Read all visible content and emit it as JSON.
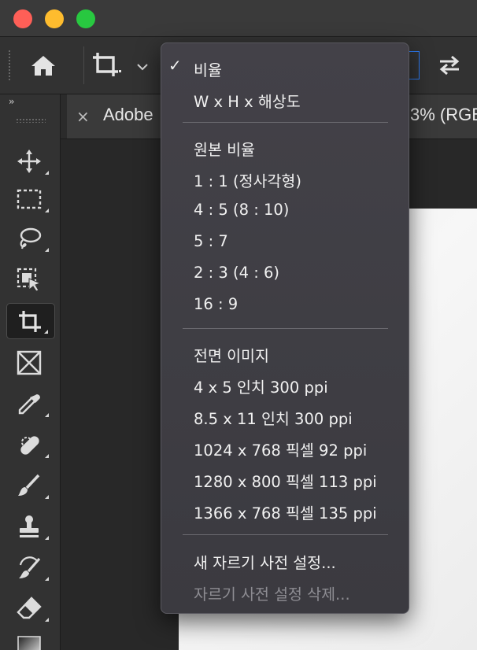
{
  "document_tab": {
    "close_glyph": "×",
    "title_left": "Adobe",
    "title_right": "3% (RGB"
  },
  "toolbar": {
    "collapse_glyph": "››",
    "tools": [
      {
        "icon": "move-icon"
      },
      {
        "icon": "rectangular-marquee-icon"
      },
      {
        "icon": "lasso-icon"
      },
      {
        "icon": "object-selection-icon"
      },
      {
        "icon": "crop-icon",
        "active": true
      },
      {
        "icon": "frame-icon"
      },
      {
        "icon": "eyedropper-icon"
      },
      {
        "icon": "spot-healing-brush-icon"
      },
      {
        "icon": "brush-icon"
      },
      {
        "icon": "clone-stamp-icon"
      },
      {
        "icon": "history-brush-icon"
      },
      {
        "icon": "eraser-icon"
      },
      {
        "icon": "gradient-icon"
      }
    ]
  },
  "options_bar": {
    "home_icon": "home-icon",
    "crop_preset_icon": "crop-icon",
    "dropdown_icon": "chevron-down-icon",
    "swap_icon": "swap-icon"
  },
  "menu": {
    "check_glyph": "✓",
    "items": [
      {
        "label": "비율",
        "checked": true
      },
      {
        "label": "W x H x 해상도"
      },
      {
        "label": "원본 비율"
      },
      {
        "label": "1 : 1 (정사각형)"
      },
      {
        "label": "4 : 5 (8 : 10)"
      },
      {
        "label": "5 : 7"
      },
      {
        "label": "2 : 3 (4 : 6)"
      },
      {
        "label": "16 : 9"
      },
      {
        "label": "전면 이미지"
      },
      {
        "label": "4 x 5 인치 300 ppi"
      },
      {
        "label": "8.5 x 11 인치 300 ppi"
      },
      {
        "label": "1024 x 768 픽셀 92 ppi"
      },
      {
        "label": "1280 x 800 픽셀 113 ppi"
      },
      {
        "label": "1366 x 768 픽셀 135 ppi"
      },
      {
        "label": "새 자르기 사전 설정..."
      },
      {
        "label": "자르기 사전 설정 삭제...",
        "disabled": true
      }
    ]
  },
  "colors": {
    "close": "#fe5f57",
    "minimize": "#febc2e",
    "maximize": "#28c840",
    "accent": "#2d7cf6"
  }
}
